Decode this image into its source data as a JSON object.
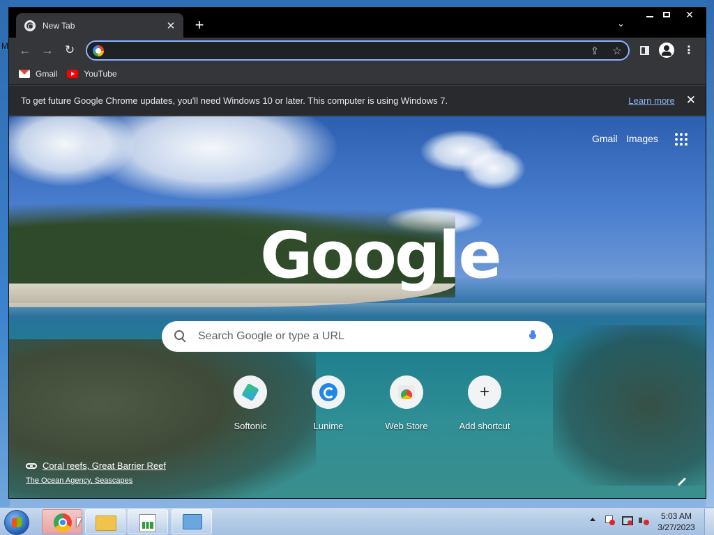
{
  "desktop": {
    "edge_letter": "M"
  },
  "browser": {
    "tab": {
      "title": "New Tab",
      "close_label": "✕"
    },
    "new_tab_label": "+",
    "tab_search_label": "⌄",
    "window_controls": {
      "close": "✕"
    },
    "omnibox": {
      "value": "",
      "placeholder": ""
    },
    "bookmarks": [
      {
        "label": "Gmail",
        "icon": "gmail-icon"
      },
      {
        "label": "YouTube",
        "icon": "youtube-icon"
      }
    ],
    "infobar": {
      "message": "To get future Google Chrome updates, you'll need Windows 10 or later. This computer is using Windows 7.",
      "link": "Learn more",
      "close_label": "✕"
    }
  },
  "ntp": {
    "top_links": {
      "gmail": "Gmail",
      "images": "Images"
    },
    "logo": "Google",
    "search_placeholder": "Search Google or type a URL",
    "shortcuts": [
      {
        "label": "Softonic",
        "icon": "softonic-icon"
      },
      {
        "label": "Lunime",
        "icon": "lunime-icon"
      },
      {
        "label": "Web Store",
        "icon": "webstore-icon"
      },
      {
        "label": "Add shortcut",
        "icon": "plus-icon"
      }
    ],
    "attribution": {
      "title": "Coral reefs, Great Barrier Reef",
      "subtitle": "The Ocean Agency, Seascapes"
    }
  },
  "taskbar": {
    "apps": [
      "chrome",
      "windows-explorer",
      "task-manager",
      "control-panel"
    ],
    "clock": {
      "time": "5:03 AM",
      "date": "3/27/2023"
    }
  },
  "colors": {
    "accent": "#8ab4f8",
    "toolbar": "#35363a",
    "titlebar": "#000000",
    "frame": "#202124"
  }
}
